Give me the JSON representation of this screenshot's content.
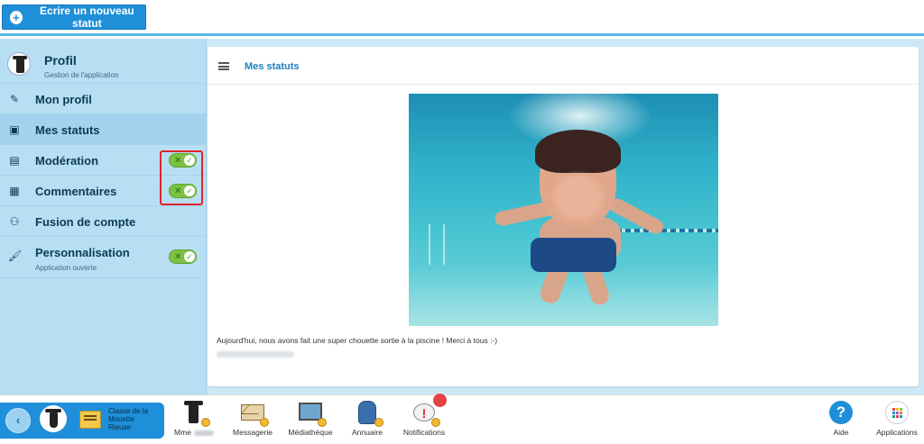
{
  "topbar": {
    "new_status_label": "Ecrire un nouveau statut"
  },
  "sidebar": {
    "profile_title": "Profil",
    "profile_subtitle": "Gestion de l'application",
    "items": [
      {
        "label": "Mon profil",
        "icon": "pencil-icon"
      },
      {
        "label": "Mes statuts",
        "icon": "status-icon"
      },
      {
        "label": "Modération",
        "icon": "chat-icon",
        "toggle": true
      },
      {
        "label": "Commentaires",
        "icon": "comment-icon",
        "toggle": true
      },
      {
        "label": "Fusion de compte",
        "icon": "users-icon"
      },
      {
        "label": "Personnalisation",
        "icon": "brush-icon",
        "toggle": true,
        "subtitle": "Application ouverte"
      }
    ]
  },
  "panel": {
    "title": "Mes statuts",
    "post_text": "Aujourd'hui, nous avons fait une super chouette sortie à la piscine ! Merci à tous :-)"
  },
  "dock": {
    "class_name": "Classe de la Mouette Rieuse",
    "apps": [
      {
        "label": "Mme",
        "icon": "person-icon"
      },
      {
        "label": "Messagerie",
        "icon": "envelope-icon"
      },
      {
        "label": "Médiathèque",
        "icon": "media-icon"
      },
      {
        "label": "Annuaire",
        "icon": "directory-icon"
      },
      {
        "label": "Notifications",
        "icon": "notification-icon"
      }
    ],
    "help_label": "Aide",
    "apps_label": "Applications"
  },
  "colors": {
    "accent": "#1e8fd8",
    "sidebar_bg": "#b8def3",
    "toggle_on": "#7cc243",
    "highlight": "#e0252a"
  }
}
